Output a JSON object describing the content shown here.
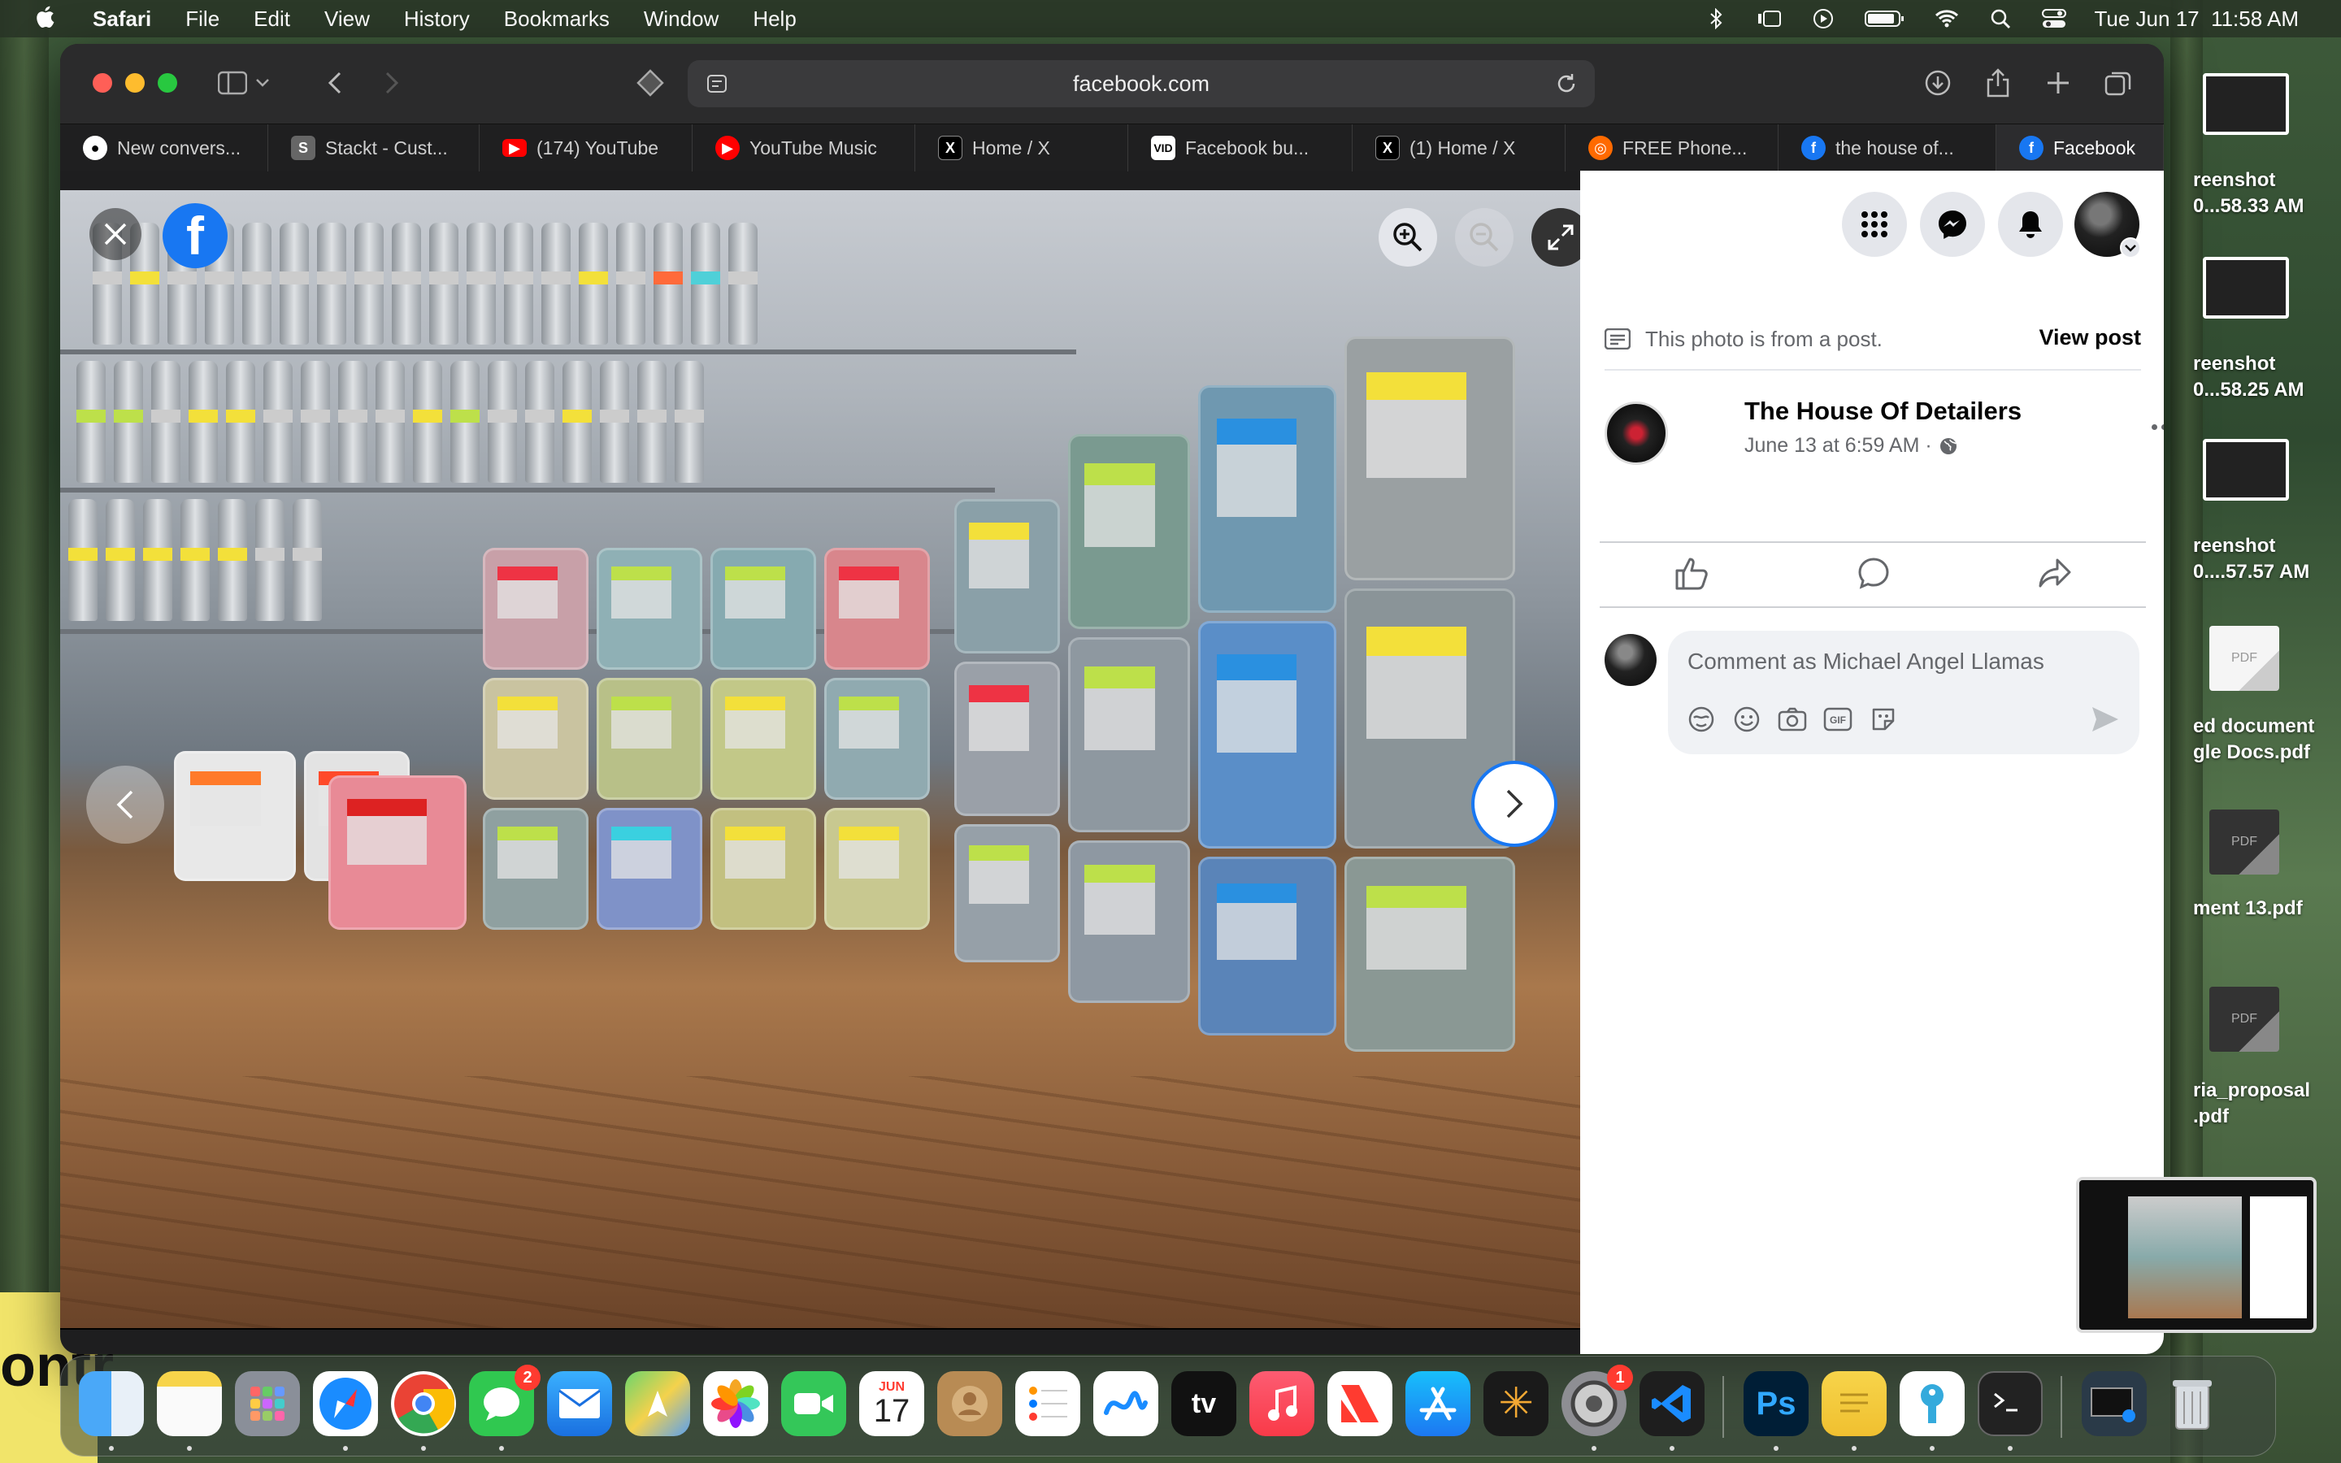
{
  "menubar": {
    "app_name": "Safari",
    "items": [
      "File",
      "Edit",
      "View",
      "History",
      "Bookmarks",
      "Window",
      "Help"
    ],
    "datetime": "Tue Jun 17  11:58 AM"
  },
  "browser": {
    "url": "facebook.com",
    "tabs": [
      {
        "label": "New convers...",
        "icon": "github-icon"
      },
      {
        "label": "Stackt - Cust...",
        "icon": "stackt-icon"
      },
      {
        "label": "(174) YouTube",
        "icon": "youtube-icon"
      },
      {
        "label": "YouTube Music",
        "icon": "youtube-music-icon"
      },
      {
        "label": "Home / X",
        "icon": "x-icon"
      },
      {
        "label": "Facebook bu...",
        "icon": "vid-icon"
      },
      {
        "label": "(1) Home / X",
        "icon": "x-icon"
      },
      {
        "label": "FREE Phone...",
        "icon": "phone-icon"
      },
      {
        "label": "the house of...",
        "icon": "facebook-icon"
      },
      {
        "label": "Facebook",
        "icon": "facebook-icon"
      }
    ],
    "active_tab_index": 9
  },
  "photo_viewer": {
    "logo": "f"
  },
  "post_panel": {
    "from_post_text": "This photo is from a post.",
    "view_post_label": "View post",
    "author_name": "The House Of Detailers",
    "post_date": "June 13 at 6:59 AM ·",
    "comment_placeholder": "Comment as Michael Angel Llamas"
  },
  "desktop": {
    "files": [
      {
        "label_line1": "reenshot",
        "label_line2": "0...58.33 AM"
      },
      {
        "label_line1": "reenshot",
        "label_line2": "0...58.25 AM"
      },
      {
        "label_line1": "reenshot",
        "label_line2": "0....57.57 AM"
      },
      {
        "label_line1": "ed document",
        "label_line2": "gle Docs.pdf"
      },
      {
        "label_line1": "ment 13.pdf",
        "label_line2": ""
      },
      {
        "label_line1": "ria_proposal",
        "label_line2": ".pdf"
      }
    ],
    "pdf_label": "PDF",
    "wallpaper_text": "ontr"
  },
  "dock": {
    "messages_badge": "2",
    "settings_badge": "1",
    "calendar_month": "JUN",
    "calendar_day": "17",
    "tv_label": "tv"
  },
  "colors": {
    "facebook_blue": "#1877f2",
    "window_bg": "#1e1e1f",
    "panel_bg": "#ffffff"
  }
}
